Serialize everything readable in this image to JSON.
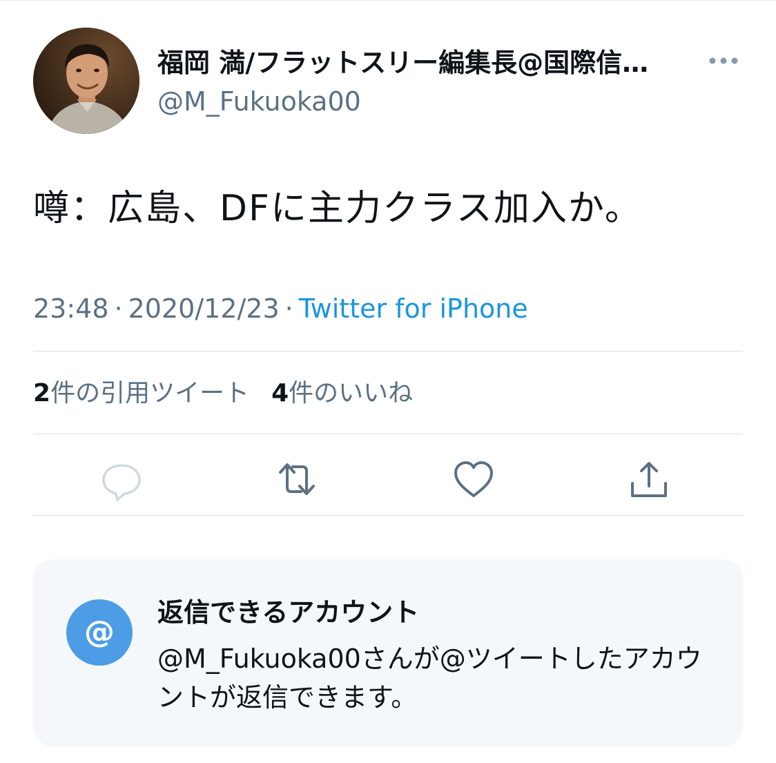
{
  "author": {
    "display_name": "福岡 満/フラットスリー編集長@国際信…",
    "handle": "@M_Fukuoka00",
    "avatar_icon": "profile-photo",
    "more_icon": "more-icon"
  },
  "tweet": {
    "text": "噂：広島、DFに主力クラス加入か。",
    "time": "23:48",
    "separator": "·",
    "date": "2020/12/23",
    "source": "Twitter for iPhone"
  },
  "stats": {
    "quotes_count": "2",
    "quotes_label": "件の引用ツイート",
    "likes_count": "4",
    "likes_label": "件のいいね"
  },
  "actions": {
    "reply_icon": "reply-icon",
    "retweet_icon": "retweet-icon",
    "like_icon": "heart-icon",
    "share_icon": "share-icon"
  },
  "reply_settings": {
    "icon_symbol": "@",
    "title": "返信できるアカウント",
    "description": "@M_Fukuoka00さんが@ツイートしたアカウントが返信できます。"
  },
  "colors": {
    "text_primary": "#0f1419",
    "text_secondary": "#5b7083",
    "link": "#1b95e0",
    "icon_gray": "#5b7083",
    "reply_box_bg": "#f5f8fa",
    "at_circle": "#4c9de6"
  }
}
